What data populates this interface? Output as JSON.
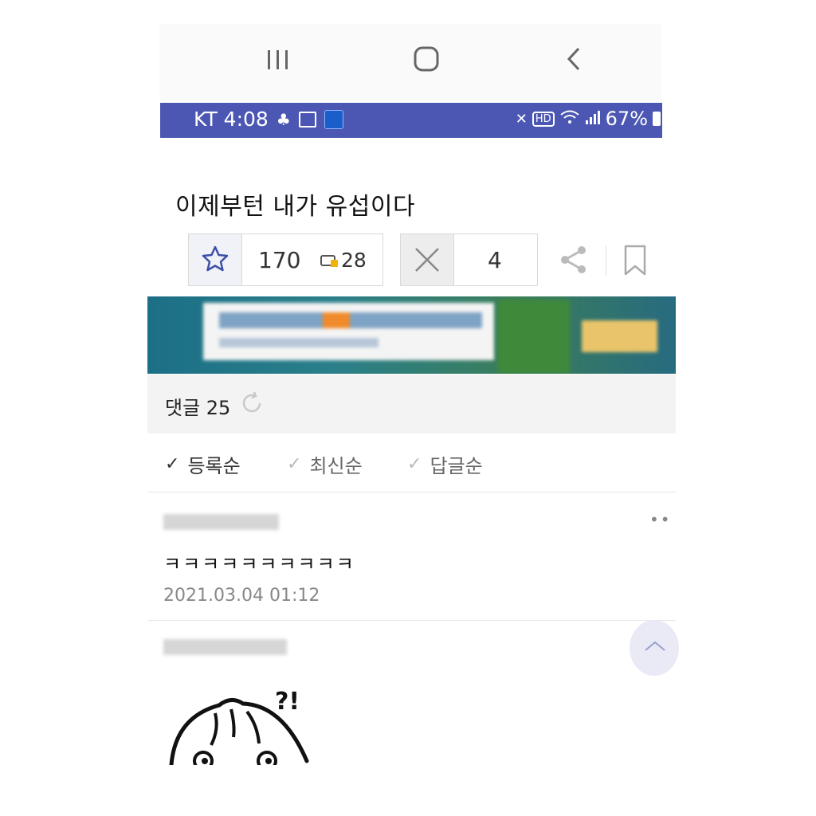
{
  "status_bar": {
    "carrier_time": "KT 4:08",
    "right_text": "67%",
    "background_color": "#4c57b3"
  },
  "post": {
    "title": "이제부턴 내가 유섭이다",
    "recommend_count": "170",
    "badge_count": "28",
    "dislike_count": "4"
  },
  "comments": {
    "header": "댓글 25",
    "sort_options": [
      {
        "label": "등록순",
        "active": true
      },
      {
        "label": "최신순",
        "active": false
      },
      {
        "label": "답글순",
        "active": false
      }
    ],
    "items": [
      {
        "text": "ㅋㅋㅋㅋㅋㅋㅋㅋㅋㅋ",
        "date": "2021.03.04 01:12"
      }
    ]
  },
  "icons": {
    "nav": [
      "recent-apps-icon",
      "home-icon",
      "back-icon"
    ],
    "actions": [
      "star-icon",
      "x-icon",
      "share-icon",
      "bookmark-icon",
      "refresh-icon",
      "scroll-top-icon",
      "more-icon"
    ]
  }
}
